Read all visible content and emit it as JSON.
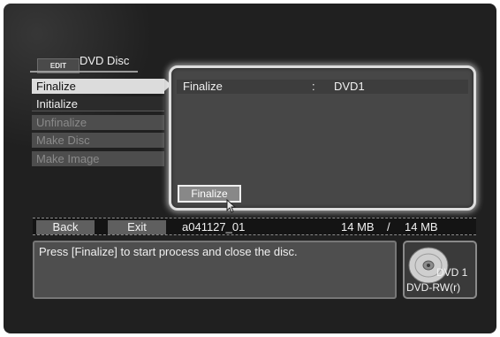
{
  "header": {
    "tag": "EDIT",
    "title": "DVD Disc"
  },
  "menu": [
    {
      "label": "Finalize",
      "state": "selected"
    },
    {
      "label": "Initialize",
      "state": "enabled"
    },
    {
      "label": "Unfinalize",
      "state": "disabled"
    },
    {
      "label": "Make Disc",
      "state": "disabled"
    },
    {
      "label": "Make Image",
      "state": "disabled"
    }
  ],
  "panel": {
    "row_label": "Finalize",
    "separator": ":",
    "row_value": "DVD1",
    "action_button": "Finalize"
  },
  "status": {
    "back": "Back",
    "exit": "Exit",
    "title_name": "a041127_01",
    "used": "14 MB",
    "separator": "/",
    "total": "14 MB"
  },
  "message": "Press [Finalize] to start process and close the disc.",
  "disc": {
    "label": "DVD 1",
    "type": "DVD-RW(r)",
    "icon": "disc-icon"
  }
}
